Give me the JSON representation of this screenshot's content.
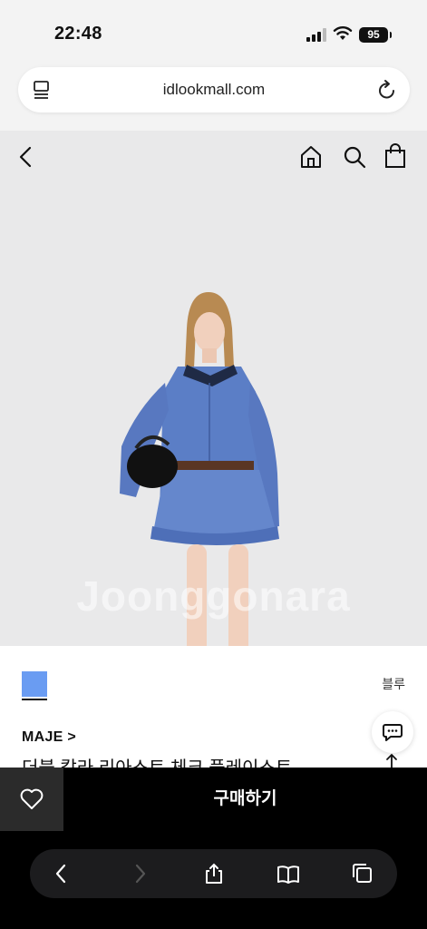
{
  "status_bar": {
    "time": "22:48",
    "battery": "95"
  },
  "browser": {
    "url": "idlookmall.com"
  },
  "image": {
    "watermark": "Joonggonara"
  },
  "product": {
    "color_label": "블루",
    "swatch_color": "#6a9cf2",
    "brand": "MAJE >",
    "name": "더블 칼라 리아스트 체크 플레이스트"
  },
  "actions": {
    "buy_label": "구매하기"
  },
  "icons": [
    "signal-icon",
    "wifi-icon",
    "tabs-icon",
    "reload-icon",
    "back-icon",
    "home-icon",
    "search-icon",
    "shopping-bag-icon",
    "chat-icon",
    "share-icon",
    "heart-icon",
    "nav-back-icon",
    "nav-forward-icon",
    "share-sheet-icon",
    "bookmarks-icon",
    "tab-switcher-icon"
  ]
}
